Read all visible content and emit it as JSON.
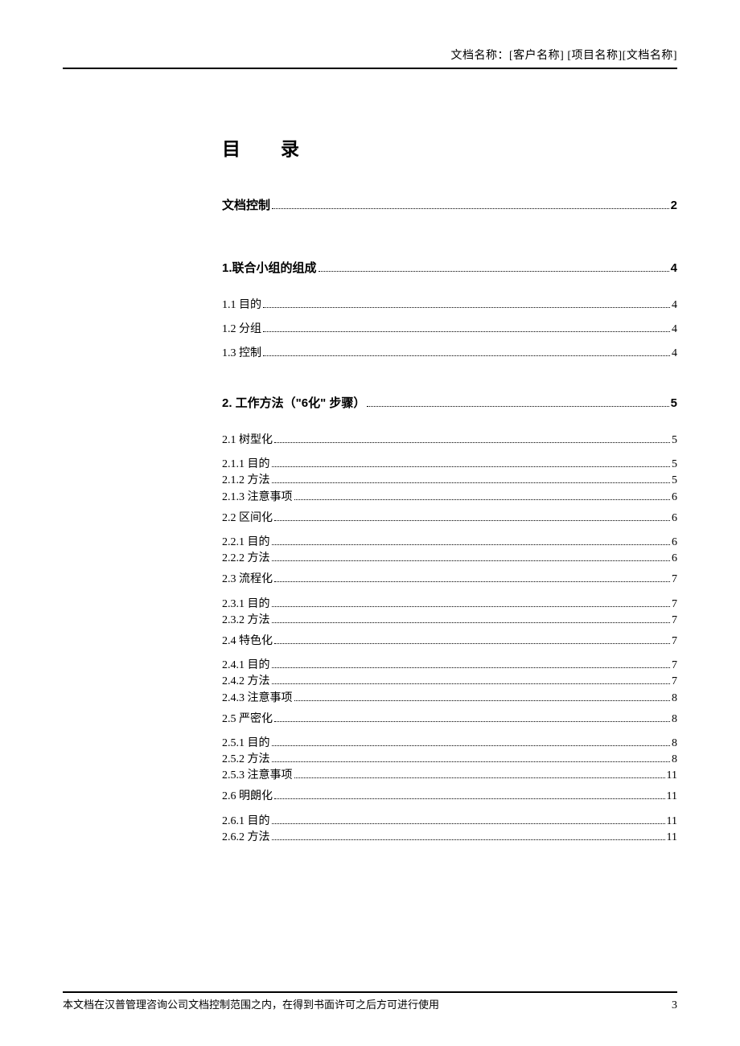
{
  "header": {
    "label_prefix": "文档名称：",
    "value": "[客户名称] [项目名称][文档名称]"
  },
  "toc": {
    "title_char1": "目",
    "title_char2": "录",
    "entries": [
      {
        "level": 0,
        "first": true,
        "label": "文档控制",
        "page": "2"
      },
      {
        "gap": true
      },
      {
        "level": 0,
        "label": "1.联合小组的组成",
        "page": "4"
      },
      {
        "level": 1,
        "label": "1.1 目的",
        "page": "4"
      },
      {
        "level": 1,
        "label": "1.2 分组",
        "page": "4"
      },
      {
        "level": 1,
        "label": "1.3 控制",
        "page": "4"
      },
      {
        "gap": true
      },
      {
        "level": 0,
        "label": "2. 工作方法（\"6化\" 步骤）",
        "page": "5"
      },
      {
        "level": 1,
        "label": "2.1 树型化",
        "page": "5"
      },
      {
        "level": 2,
        "label": "2.1.1 目的",
        "page": "5"
      },
      {
        "level": 2,
        "label": "2.1.2 方法",
        "page": "5"
      },
      {
        "level": 2,
        "label": "2.1.3 注意事项",
        "page": "6"
      },
      {
        "level": 1,
        "label": "2.2 区间化",
        "page": "6"
      },
      {
        "level": 2,
        "label": "2.2.1 目的",
        "page": "6"
      },
      {
        "level": 2,
        "label": "2.2.2 方法",
        "page": "6"
      },
      {
        "level": 1,
        "label": "2.3 流程化",
        "page": "7"
      },
      {
        "level": 2,
        "label": "2.3.1 目的",
        "page": "7"
      },
      {
        "level": 2,
        "label": "2.3.2 方法",
        "page": "7"
      },
      {
        "level": 1,
        "label": "2.4 特色化",
        "page": "7"
      },
      {
        "level": 2,
        "label": "2.4.1 目的",
        "page": "7"
      },
      {
        "level": 2,
        "label": "2.4.2 方法",
        "page": "7"
      },
      {
        "level": 2,
        "label": "2.4.3 注意事项",
        "page": "8"
      },
      {
        "level": 1,
        "label": "2.5 严密化",
        "page": "8"
      },
      {
        "level": 2,
        "label": "2.5.1 目的",
        "page": "8"
      },
      {
        "level": 2,
        "label": "2.5.2 方法",
        "page": "8"
      },
      {
        "level": 2,
        "label": "2.5.3 注意事项",
        "page": "11"
      },
      {
        "level": 1,
        "label": "2.6 明朗化",
        "page": "11"
      },
      {
        "level": 2,
        "label": "2.6.1 目的",
        "page": "11"
      },
      {
        "level": 2,
        "label": "2.6.2 方法",
        "page": "11"
      }
    ]
  },
  "footer": {
    "text": "本文档在汉普管理咨询公司文档控制范围之内，在得到书面许可之后方可进行使用",
    "page_number": "3"
  }
}
